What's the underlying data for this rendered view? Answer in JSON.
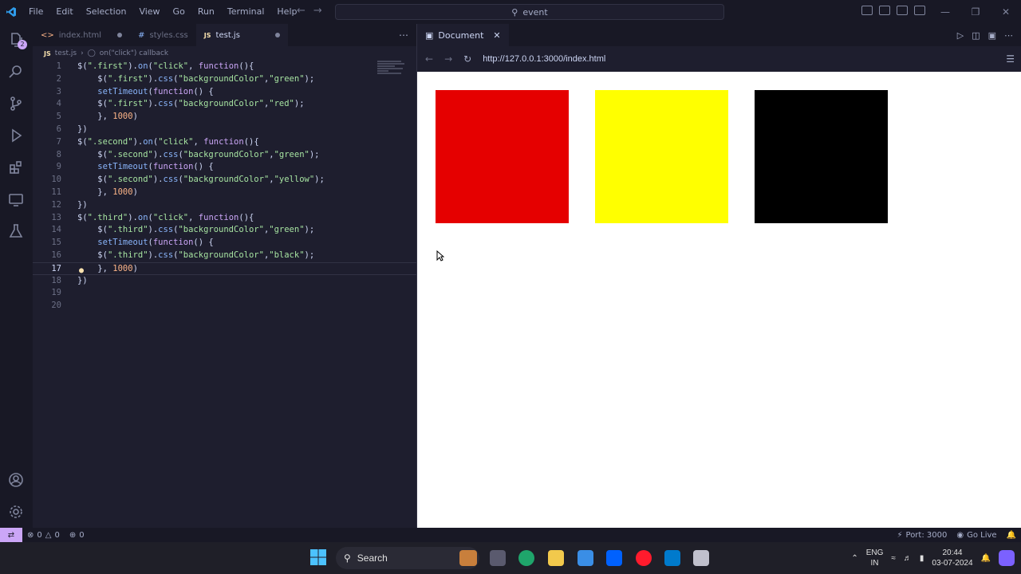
{
  "menu": [
    "File",
    "Edit",
    "Selection",
    "View",
    "Go",
    "Run",
    "Terminal",
    "Help"
  ],
  "command_center": "event",
  "tabs": [
    {
      "label": "index.html",
      "icon": "<>"
    },
    {
      "label": "styles.css",
      "icon": "#"
    },
    {
      "label": "test.js",
      "icon": "JS"
    }
  ],
  "breadcrumb": {
    "file": "test.js",
    "badge": "JS",
    "symbol": "on(\"click\") callback"
  },
  "activity_badge": "2",
  "code_lines": [
    {
      "n": "1",
      "tokens": [
        [
          "d",
          "$("
        ],
        [
          "s",
          "\".first\""
        ],
        [
          "d",
          ")."
        ],
        [
          "f",
          "on"
        ],
        [
          "d",
          "("
        ],
        [
          "s",
          "\"click\""
        ],
        [
          "d",
          ", "
        ],
        [
          "k",
          "function"
        ],
        [
          "d",
          "(){"
        ]
      ]
    },
    {
      "n": "2",
      "tokens": [
        [
          "d",
          "    $("
        ],
        [
          "s",
          "\".first\""
        ],
        [
          "d",
          ")."
        ],
        [
          "f",
          "css"
        ],
        [
          "d",
          "("
        ],
        [
          "s",
          "\"backgroundColor\""
        ],
        [
          "d",
          ","
        ],
        [
          "s",
          "\"green\""
        ],
        [
          "d",
          ");"
        ]
      ]
    },
    {
      "n": "3",
      "tokens": [
        [
          "d",
          "    "
        ],
        [
          "f",
          "setTimeout"
        ],
        [
          "d",
          "("
        ],
        [
          "k",
          "function"
        ],
        [
          "d",
          "() {"
        ]
      ]
    },
    {
      "n": "4",
      "tokens": [
        [
          "d",
          "    $("
        ],
        [
          "s",
          "\".first\""
        ],
        [
          "d",
          ")."
        ],
        [
          "f",
          "css"
        ],
        [
          "d",
          "("
        ],
        [
          "s",
          "\"backgroundColor\""
        ],
        [
          "d",
          ","
        ],
        [
          "s",
          "\"red\""
        ],
        [
          "d",
          ");"
        ]
      ]
    },
    {
      "n": "5",
      "tokens": [
        [
          "d",
          "    }, "
        ],
        [
          "n",
          "1000"
        ],
        [
          "d",
          ")"
        ]
      ]
    },
    {
      "n": "6",
      "tokens": [
        [
          "d",
          "})"
        ]
      ]
    },
    {
      "n": "7",
      "tokens": [
        [
          "d",
          "$("
        ],
        [
          "s",
          "\".second\""
        ],
        [
          "d",
          ")."
        ],
        [
          "f",
          "on"
        ],
        [
          "d",
          "("
        ],
        [
          "s",
          "\"click\""
        ],
        [
          "d",
          ", "
        ],
        [
          "k",
          "function"
        ],
        [
          "d",
          "(){"
        ]
      ]
    },
    {
      "n": "8",
      "tokens": [
        [
          "d",
          "    $("
        ],
        [
          "s",
          "\".second\""
        ],
        [
          "d",
          ")."
        ],
        [
          "f",
          "css"
        ],
        [
          "d",
          "("
        ],
        [
          "s",
          "\"backgroundColor\""
        ],
        [
          "d",
          ","
        ],
        [
          "s",
          "\"green\""
        ],
        [
          "d",
          ");"
        ]
      ]
    },
    {
      "n": "9",
      "tokens": [
        [
          "d",
          "    "
        ],
        [
          "f",
          "setTimeout"
        ],
        [
          "d",
          "("
        ],
        [
          "k",
          "function"
        ],
        [
          "d",
          "() {"
        ]
      ]
    },
    {
      "n": "10",
      "tokens": [
        [
          "d",
          "    $("
        ],
        [
          "s",
          "\".second\""
        ],
        [
          "d",
          ")."
        ],
        [
          "f",
          "css"
        ],
        [
          "d",
          "("
        ],
        [
          "s",
          "\"backgroundColor\""
        ],
        [
          "d",
          ","
        ],
        [
          "s",
          "\"yellow\""
        ],
        [
          "d",
          ");"
        ]
      ]
    },
    {
      "n": "11",
      "tokens": [
        [
          "d",
          "    }, "
        ],
        [
          "n",
          "1000"
        ],
        [
          "d",
          ")"
        ]
      ]
    },
    {
      "n": "12",
      "tokens": [
        [
          "d",
          "})"
        ]
      ]
    },
    {
      "n": "13",
      "tokens": [
        [
          "d",
          "$("
        ],
        [
          "s",
          "\".third\""
        ],
        [
          "d",
          ")."
        ],
        [
          "f",
          "on"
        ],
        [
          "d",
          "("
        ],
        [
          "s",
          "\"click\""
        ],
        [
          "d",
          ", "
        ],
        [
          "k",
          "function"
        ],
        [
          "d",
          "(){"
        ]
      ]
    },
    {
      "n": "14",
      "tokens": [
        [
          "d",
          "    $("
        ],
        [
          "s",
          "\".third\""
        ],
        [
          "d",
          ")."
        ],
        [
          "f",
          "css"
        ],
        [
          "d",
          "("
        ],
        [
          "s",
          "\"backgroundColor\""
        ],
        [
          "d",
          ","
        ],
        [
          "s",
          "\"green\""
        ],
        [
          "d",
          ");"
        ]
      ]
    },
    {
      "n": "15",
      "tokens": [
        [
          "d",
          "    "
        ],
        [
          "f",
          "setTimeout"
        ],
        [
          "d",
          "("
        ],
        [
          "k",
          "function"
        ],
        [
          "d",
          "() {"
        ]
      ]
    },
    {
      "n": "16",
      "tokens": [
        [
          "d",
          "    $("
        ],
        [
          "s",
          "\".third\""
        ],
        [
          "d",
          ")."
        ],
        [
          "f",
          "css"
        ],
        [
          "d",
          "("
        ],
        [
          "s",
          "\"backgroundColor\""
        ],
        [
          "d",
          ","
        ],
        [
          "s",
          "\"black\""
        ],
        [
          "d",
          ");"
        ]
      ]
    },
    {
      "n": "17",
      "tokens": [
        [
          "d",
          "    }, "
        ],
        [
          "n",
          "1000"
        ],
        [
          "d",
          ")"
        ]
      ]
    },
    {
      "n": "18",
      "tokens": [
        [
          "d",
          "})"
        ]
      ]
    },
    {
      "n": "19",
      "tokens": []
    },
    {
      "n": "20",
      "tokens": []
    }
  ],
  "preview": {
    "tab_title": "Document",
    "url": "http://127.0.0.1:3000/index.html",
    "boxes": [
      {
        "name": "first",
        "color": "#e50000"
      },
      {
        "name": "second",
        "color": "#ffff00"
      },
      {
        "name": "third",
        "color": "#000000"
      }
    ]
  },
  "status": {
    "errors": "0",
    "warnings": "0",
    "ports": "0",
    "port": "Port: 3000",
    "go_live": "Go Live"
  },
  "taskbar": {
    "search": "Search",
    "lang_top": "ENG",
    "lang_bottom": "IN",
    "time": "20:44",
    "date": "03-07-2024"
  },
  "colors": {
    "accent": "#cba6f7",
    "string": "#a6e3a1",
    "keyword": "#cba6f7",
    "function": "#89b4fa"
  }
}
